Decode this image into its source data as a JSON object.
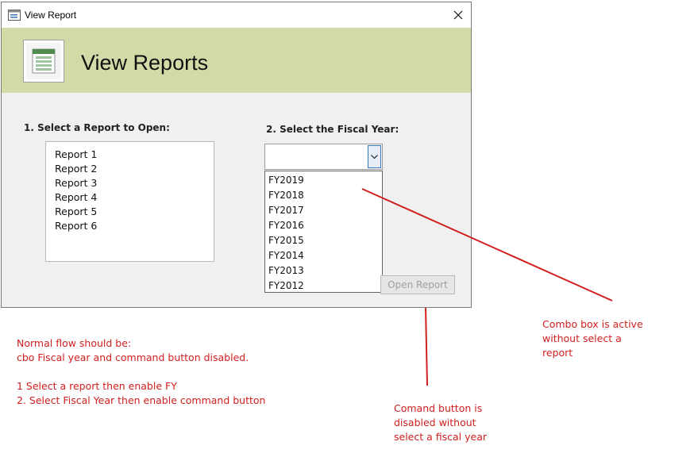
{
  "window": {
    "title": "View Report",
    "header_title": "View Reports",
    "colors": {
      "header_bg": "#d3d9a7",
      "window_bg": "#f0f0f0",
      "annotation": "#d0201f"
    }
  },
  "icons": {
    "title": "form-icon",
    "close": "close-icon",
    "header": "form-view-icon",
    "combo": "chevron-down-icon"
  },
  "reports": {
    "label": "1. Select a Report to Open:",
    "items": [
      "Report 1",
      "Report 2",
      "Report 3",
      "Report 4",
      "Report 5",
      "Report 6"
    ]
  },
  "fiscal_year": {
    "label": "2. Select the Fiscal Year:",
    "value": "",
    "options": [
      "FY2019",
      "FY2018",
      "FY2017",
      "FY2016",
      "FY2015",
      "FY2014",
      "FY2013",
      "FY2012"
    ]
  },
  "open_button": {
    "label": "Open Report",
    "disabled": true
  },
  "annotations": {
    "flow": [
      "Normal flow should be:",
      "cbo Fiscal year and command button disabled.",
      "",
      "1 Select a report then enable FY",
      "2. Select Fiscal Year then enable command button"
    ],
    "button_note": [
      "Comand button is",
      "disabled without",
      "select a fiscal year"
    ],
    "combo_note": [
      "Combo box is active",
      "without select a",
      "report"
    ]
  }
}
